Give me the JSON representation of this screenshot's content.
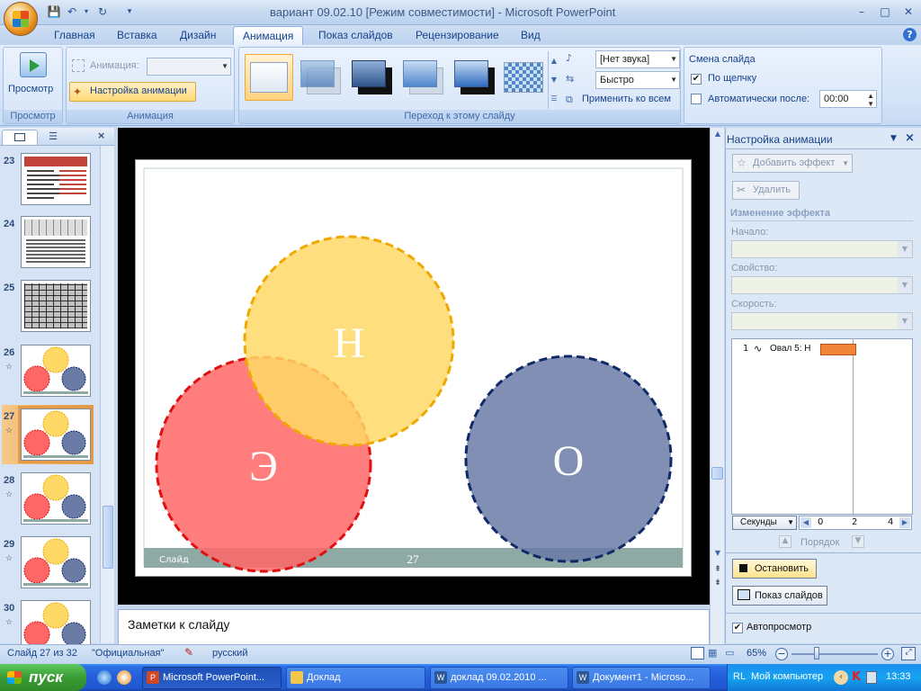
{
  "window": {
    "title": "вариант 09.02.10 [Режим совместимости] - Microsoft PowerPoint",
    "controls": [
      "–",
      "□",
      "✕"
    ]
  },
  "tabs": [
    {
      "label": "Главная",
      "active": false
    },
    {
      "label": "Вставка",
      "active": false
    },
    {
      "label": "Дизайн",
      "active": false
    },
    {
      "label": "Анимация",
      "active": true
    },
    {
      "label": "Показ слайдов",
      "active": false
    },
    {
      "label": "Рецензирование",
      "active": false
    },
    {
      "label": "Вид",
      "active": false
    }
  ],
  "ribbon": {
    "preview": {
      "button": "Просмотр",
      "group": "Просмотр"
    },
    "animation": {
      "label": "Анимация:",
      "custom_button": "Настройка анимации",
      "group": "Анимация"
    },
    "transition": {
      "sound": "[Нет звука]",
      "speed": "Быстро",
      "apply_all": "Применить ко всем",
      "group": "Переход к этому слайду"
    },
    "advance": {
      "title": "Смена слайда",
      "on_click": "По щелчку",
      "on_click_checked": true,
      "auto_after": "Автоматически после:",
      "auto_checked": false,
      "time": "00:00"
    }
  },
  "thumbnails": [
    {
      "num": "23",
      "kind": "text"
    },
    {
      "num": "24",
      "kind": "table"
    },
    {
      "num": "25",
      "kind": "grid"
    },
    {
      "num": "26",
      "kind": "venn"
    },
    {
      "num": "27",
      "kind": "venn",
      "selected": true
    },
    {
      "num": "28",
      "kind": "venn"
    },
    {
      "num": "29",
      "kind": "venn"
    },
    {
      "num": "30",
      "kind": "venn"
    }
  ],
  "slide": {
    "circles": [
      {
        "letter": "Н",
        "fill": "#ffd966",
        "stroke": "#f0a800"
      },
      {
        "letter": "Э",
        "fill": "#ff6666",
        "stroke": "#e01010"
      },
      {
        "letter": "О",
        "fill": "#6a7ba6",
        "stroke": "#0f2a66"
      }
    ],
    "footer_left": "Слайд",
    "footer_number": "27"
  },
  "notes": {
    "placeholder": "Заметки к слайду"
  },
  "task_pane": {
    "title": "Настройка анимации",
    "add_effect": "Добавить эффект",
    "remove": "Удалить",
    "change_effect": "Изменение эффекта",
    "start_label": "Начало:",
    "property_label": "Свойство:",
    "speed_label": "Скорость:",
    "list_item": {
      "index": "1",
      "name": "Овал 5: Н"
    },
    "timeline": {
      "unit": "Секунды",
      "ticks": [
        "0",
        "2",
        "4"
      ]
    },
    "order": "Порядок",
    "stop": "Остановить",
    "slideshow": "Показ слайдов",
    "autopreview": "Автопросмотр",
    "autopreview_checked": true
  },
  "statusbar": {
    "slide": "Слайд 27 из 32",
    "theme": "\"Официальная\"",
    "language": "русский",
    "zoom": "65%"
  },
  "taskbar": {
    "start": "пуск",
    "tasks": [
      {
        "label": "Microsoft PowerPoint...",
        "active": true
      },
      {
        "label": "Доклад",
        "active": false
      },
      {
        "label": "доклад 09.02.2010 ...",
        "active": false
      },
      {
        "label": "Документ1 - Microso...",
        "active": false
      }
    ],
    "tray": {
      "lang": "RL",
      "computer": "Мой компьютер",
      "time": "13:33"
    }
  }
}
